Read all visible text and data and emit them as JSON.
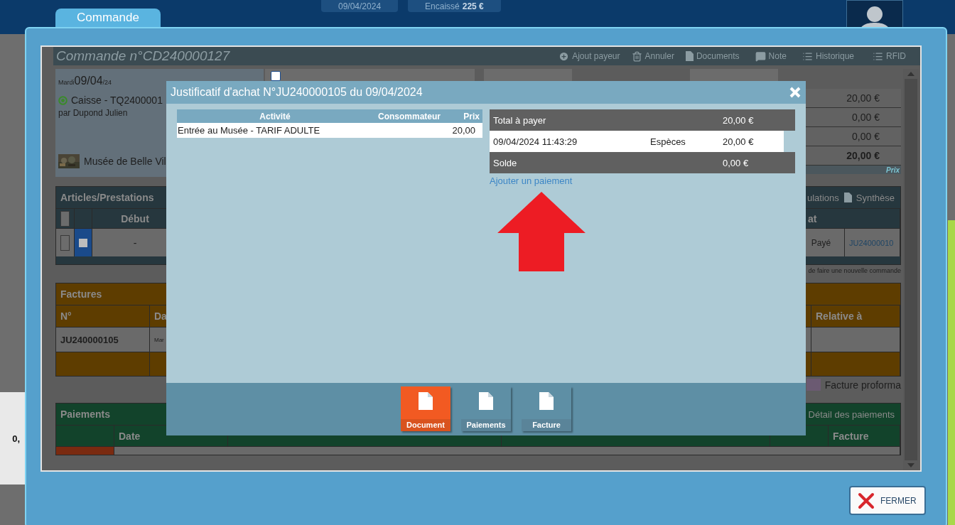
{
  "app_bar": {
    "tab": "Commande",
    "date": "09/04/2024",
    "cashed_label": "Encaissé",
    "cashed_amount": "225 €"
  },
  "side_total": "0,",
  "order": {
    "title": "Commande n°CD240000127",
    "actions": [
      {
        "label": "Ajout payeur",
        "kind": "plus"
      },
      {
        "label": "Annuler",
        "kind": "trash"
      },
      {
        "label": "Documents",
        "kind": "doc"
      },
      {
        "label": "Note",
        "kind": "note"
      },
      {
        "label": "Historique",
        "kind": "list"
      },
      {
        "label": "RFID",
        "kind": "list"
      }
    ],
    "day": "Mardi",
    "date": "09/04",
    "year": "/24",
    "source": "Caisse - TQ2400001",
    "author": "par Dupond Julien",
    "venue": "Musée de Belle Vil",
    "no_date": {
      "checked": false
    },
    "amounts": [
      {
        "value": "20,00 €",
        "bold": false
      },
      {
        "value": "0,00 €",
        "bold": false
      },
      {
        "value": "0,00 €",
        "bold": false
      },
      {
        "value": "20,00 €",
        "bold": true
      }
    ],
    "price_note": "Prix",
    "articles": {
      "title": "Articles/Prestations",
      "actions": [
        "ulations",
        "Synthèse"
      ],
      "columns": [
        "Début",
        "at"
      ],
      "header_check": {
        "checked": false
      },
      "checks": [
        {
          "checked": false
        },
        {
          "checked": true
        }
      ],
      "row": {
        "start": "-",
        "status": "Payé",
        "invoice": "JU24000010"
      },
      "note": "de faire une nouvelle commande"
    },
    "invoices": {
      "title": "Factures",
      "columns": [
        "N°",
        "Da",
        "Relative à"
      ],
      "row": {
        "number": "JU240000105",
        "date": "Mar"
      },
      "legend": [
        {
          "label": "Facture proforma",
          "color": "#6b5a72"
        }
      ]
    },
    "payments": {
      "title": "Paiements",
      "link": "Détail des paiements",
      "columns": [
        "Date",
        "Facture"
      ]
    }
  },
  "receipt": {
    "title": "Justificatif d'achat N°JU240000105 du 09/04/2024",
    "columns": [
      "Activité",
      "Consommateur",
      "Prix"
    ],
    "lines": [
      {
        "activity": "Entrée au Musée - TARIF ADULTE",
        "price": "20,00"
      }
    ],
    "total": {
      "label": "Total à payer",
      "amount": "20,00 €"
    },
    "payments": [
      {
        "date": "09/04/2024 11:43:29",
        "mode": "Espèces",
        "amount": "20,00 €"
      }
    ],
    "balance": {
      "label": "Solde",
      "amount": "0,00 €"
    },
    "add_payment": "Ajouter un paiement",
    "tabs": [
      {
        "label": "Document",
        "selected": true
      },
      {
        "label": "Paiements",
        "selected": false
      },
      {
        "label": "Facture",
        "selected": false
      }
    ]
  },
  "close_button": "FERMER"
}
